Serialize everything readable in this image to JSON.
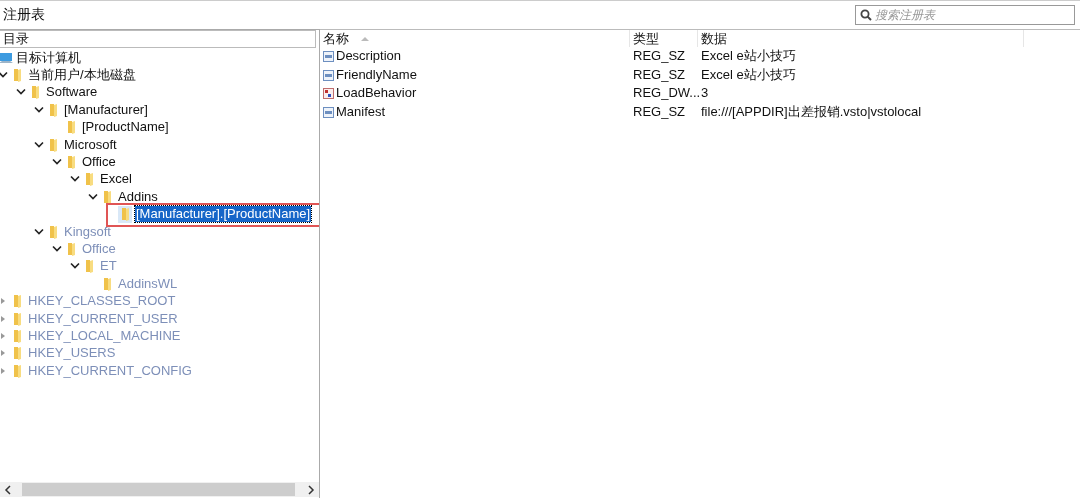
{
  "window": {
    "title": "注册表"
  },
  "search": {
    "placeholder": "搜索注册表"
  },
  "tree": {
    "header": "目录",
    "root": {
      "label": "目标计算机",
      "kind": "computer",
      "children": [
        {
          "label": "当前用户/本地磁盘",
          "expanded": true,
          "dimmed": false,
          "selected": false,
          "children": [
            {
              "label": "Software",
              "expanded": true,
              "dimmed": false,
              "selected": false,
              "children": [
                {
                  "label": "[Manufacturer]",
                  "expanded": true,
                  "dimmed": false,
                  "selected": false,
                  "children": [
                    {
                      "label": "[ProductName]",
                      "dimmed": false,
                      "selected": false
                    }
                  ]
                },
                {
                  "label": "Microsoft",
                  "expanded": true,
                  "dimmed": false,
                  "selected": false,
                  "children": [
                    {
                      "label": "Office",
                      "expanded": true,
                      "dimmed": false,
                      "selected": false,
                      "children": [
                        {
                          "label": "Excel",
                          "expanded": true,
                          "dimmed": false,
                          "selected": false,
                          "children": [
                            {
                              "label": "Addins",
                              "expanded": true,
                              "dimmed": false,
                              "selected": false,
                              "children": [
                                {
                                  "label": "[Manufacturer].[ProductName]",
                                  "dimmed": false,
                                  "selected": true,
                                  "highlighted": true
                                }
                              ]
                            }
                          ]
                        }
                      ]
                    }
                  ]
                },
                {
                  "label": "Kingsoft",
                  "expanded": true,
                  "dimmed": true,
                  "selected": false,
                  "children": [
                    {
                      "label": "Office",
                      "expanded": true,
                      "dimmed": true,
                      "selected": false,
                      "children": [
                        {
                          "label": "ET",
                          "expanded": true,
                          "dimmed": true,
                          "selected": false,
                          "children": [
                            {
                              "label": "AddinsWL",
                              "dimmed": true,
                              "selected": false
                            }
                          ]
                        }
                      ]
                    }
                  ]
                }
              ]
            }
          ]
        },
        {
          "label": "HKEY_CLASSES_ROOT",
          "expanded": false,
          "dimmed": true,
          "selected": false
        },
        {
          "label": "HKEY_CURRENT_USER",
          "expanded": false,
          "dimmed": true,
          "selected": false
        },
        {
          "label": "HKEY_LOCAL_MACHINE",
          "expanded": false,
          "dimmed": true,
          "selected": false
        },
        {
          "label": "HKEY_USERS",
          "expanded": false,
          "dimmed": true,
          "selected": false
        },
        {
          "label": "HKEY_CURRENT_CONFIG",
          "expanded": false,
          "dimmed": true,
          "selected": false
        }
      ]
    }
  },
  "values": {
    "columns": [
      "名称",
      "类型",
      "数据"
    ],
    "rows": [
      {
        "name": "Description",
        "kind": "string",
        "type": "REG_SZ",
        "data": "Excel e站小技巧"
      },
      {
        "name": "FriendlyName",
        "kind": "string",
        "type": "REG_SZ",
        "data": "Excel e站小技巧"
      },
      {
        "name": "LoadBehavior",
        "kind": "dword",
        "type": "REG_DW...",
        "data": "3"
      },
      {
        "name": "Manifest",
        "kind": "string",
        "type": "REG_SZ",
        "data": "file:///[APPDIR]出差报销.vsto|vstolocal"
      }
    ]
  }
}
